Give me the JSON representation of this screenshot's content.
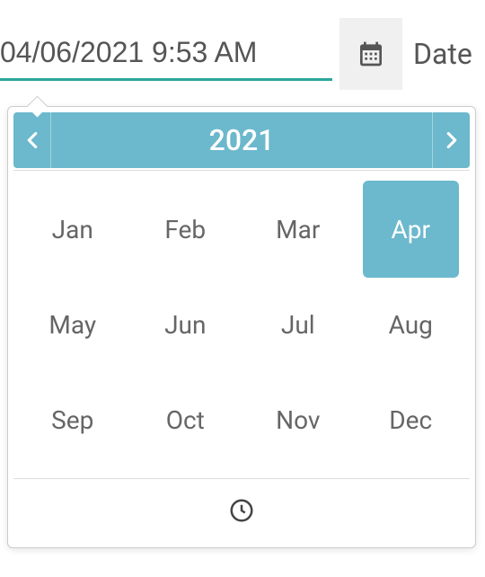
{
  "input": {
    "value": "04/06/2021 9:53 AM"
  },
  "label": "Date",
  "picker": {
    "year": "2021",
    "months": [
      "Jan",
      "Feb",
      "Mar",
      "Apr",
      "May",
      "Jun",
      "Jul",
      "Aug",
      "Sep",
      "Oct",
      "Nov",
      "Dec"
    ],
    "selected": "Apr"
  }
}
